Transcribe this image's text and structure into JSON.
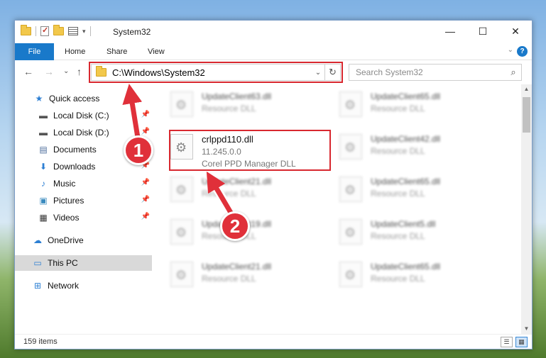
{
  "window": {
    "title": "System32",
    "caption": {
      "minimize": "—",
      "maximize": "☐",
      "close": "✕"
    }
  },
  "ribbon": {
    "tabs": [
      "File",
      "Home",
      "Share",
      "View"
    ],
    "expand": "⌄",
    "help": "?"
  },
  "nav": {
    "back": "←",
    "forward": "→",
    "recent": "⌄",
    "up": "↑",
    "address": "C:\\Windows\\System32",
    "address_drop": "⌄",
    "refresh": "↻",
    "search_placeholder": "Search System32",
    "search_icon": "⌕"
  },
  "sidebar": {
    "items": [
      {
        "label": "Quick access",
        "icon": "star-icon",
        "glyph": "★",
        "pinned": false
      },
      {
        "label": "Local Disk (C:)",
        "icon": "drive-icon",
        "glyph": "▬",
        "pinned": true
      },
      {
        "label": "Local Disk (D:)",
        "icon": "drive-icon",
        "glyph": "▬",
        "pinned": true
      },
      {
        "label": "Documents",
        "icon": "documents-icon",
        "glyph": "▤",
        "pinned": true
      },
      {
        "label": "Downloads",
        "icon": "downloads-icon",
        "glyph": "⬇",
        "pinned": true
      },
      {
        "label": "Music",
        "icon": "music-icon",
        "glyph": "♪",
        "pinned": true
      },
      {
        "label": "Pictures",
        "icon": "pictures-icon",
        "glyph": "▣",
        "pinned": true
      },
      {
        "label": "Videos",
        "icon": "videos-icon",
        "glyph": "▦",
        "pinned": true
      },
      {
        "label": "OneDrive",
        "icon": "cloud-icon",
        "glyph": "☁",
        "pinned": false
      },
      {
        "label": "This PC",
        "icon": "computer-icon",
        "glyph": "▭",
        "pinned": false,
        "selected": true
      },
      {
        "label": "Network",
        "icon": "network-icon",
        "glyph": "⊞",
        "pinned": false
      }
    ],
    "pin_glyph": "📌"
  },
  "files": {
    "left_column": [
      {
        "name": "UpdateClient63.dll",
        "line1": "Resource DLL",
        "line2": ""
      },
      {
        "name": "crlppd110.dll",
        "line1": "11.245.0.0",
        "line2": "Corel PPD Manager DLL",
        "highlighted": true
      },
      {
        "name": "UpdateClient21.dll",
        "line1": "Resource DLL",
        "line2": ""
      },
      {
        "name": "UpdateClient19.dll",
        "line1": "Resource DLL",
        "line2": ""
      },
      {
        "name": "UpdateClient21.dll",
        "line1": "Resource DLL",
        "line2": ""
      }
    ],
    "right_column": [
      {
        "name": "UpdateClient65.dll",
        "line1": "Resource DLL",
        "line2": ""
      },
      {
        "name": "UpdateClient42.dll",
        "line1": "Resource DLL",
        "line2": ""
      },
      {
        "name": "UpdateClient65.dll",
        "line1": "Resource DLL",
        "line2": ""
      },
      {
        "name": "UpdateClient5.dll",
        "line1": "Resource DLL",
        "line2": ""
      },
      {
        "name": "UpdateClient65.dll",
        "line1": "Resource DLL",
        "line2": ""
      }
    ]
  },
  "status": {
    "count": "159 items",
    "view_details": "☰",
    "view_tiles": "▦"
  },
  "annotations": {
    "step1": "1",
    "step2": "2",
    "color": "#e0303a"
  },
  "colors": {
    "accent": "#1979ca",
    "highlight": "#d8282f"
  }
}
